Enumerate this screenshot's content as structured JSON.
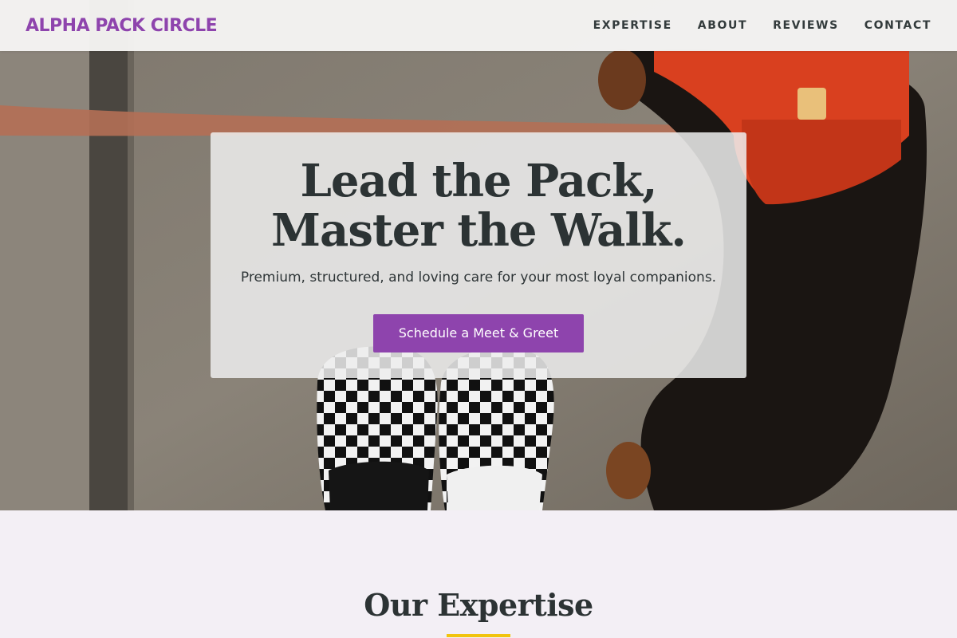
{
  "brand": {
    "name": "ALPHA PACK CIRCLE"
  },
  "nav": {
    "items": [
      {
        "label": "EXPERTISE"
      },
      {
        "label": "ABOUT"
      },
      {
        "label": "REVIEWS"
      },
      {
        "label": "CONTACT"
      }
    ]
  },
  "hero": {
    "title": "Lead the Pack, Master the Walk.",
    "subtitle": "Premium, structured, and loving care for your most loyal companions.",
    "cta_label": "Schedule a Meet & Greet"
  },
  "expertise": {
    "title": "Our Expertise"
  },
  "colors": {
    "brand": "#8e44ad",
    "accent": "#f1c40f",
    "text": "#2c3334",
    "section_bg": "#f3eff5"
  }
}
